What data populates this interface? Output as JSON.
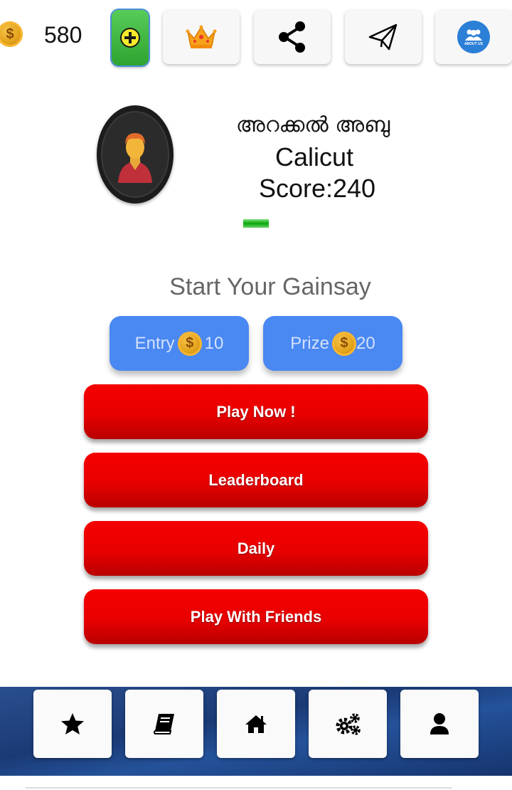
{
  "header": {
    "coin_symbol": "$",
    "coins": "580",
    "add_coins_icon": "plus-circle-icon",
    "tiles": [
      {
        "icon": "crown-icon"
      },
      {
        "icon": "share-icon"
      },
      {
        "icon": "paper-plane-icon"
      },
      {
        "icon": "about-us-icon",
        "label": "ABOUT US"
      }
    ]
  },
  "profile": {
    "name": "അറക്കൽ അബു",
    "city": "Calicut",
    "score": "Score:240",
    "progress": 0.1
  },
  "game": {
    "heading": "Start Your Gainsay",
    "entry_label": "Entry",
    "entry_value": "10",
    "prize_label": "Prize",
    "prize_value": "20",
    "coin_symbol": "$"
  },
  "actions": {
    "play_now": "Play Now !",
    "leaderboard": "Leaderboard",
    "daily": "Daily",
    "play_with_friends": "Play With Friends"
  },
  "bottom_nav": [
    {
      "icon": "star-icon"
    },
    {
      "icon": "book-icon"
    },
    {
      "icon": "home-icon"
    },
    {
      "icon": "settings-icon"
    },
    {
      "icon": "user-icon"
    }
  ],
  "colors": {
    "primary_button": "#e80000",
    "pill_blue": "#4a88f2",
    "nav_blue": "#1a3a75",
    "add_green": "#3fb93f"
  }
}
